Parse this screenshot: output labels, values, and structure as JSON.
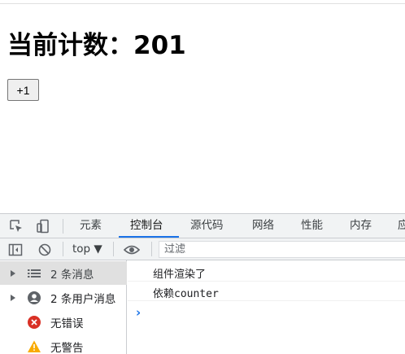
{
  "page": {
    "title": "当前计数：201",
    "increment_button": "+1"
  },
  "devtools": {
    "tabs": [
      {
        "label": "元素",
        "active": false
      },
      {
        "label": "控制台",
        "active": true
      },
      {
        "label": "源代码",
        "active": false
      },
      {
        "label": "网络",
        "active": false
      },
      {
        "label": "性能",
        "active": false
      },
      {
        "label": "内存",
        "active": false
      },
      {
        "label": "应",
        "active": false
      }
    ],
    "toolbar": {
      "context": "top ▼",
      "filter_placeholder": "过滤"
    },
    "sidebar": [
      {
        "label": "2 条消息",
        "icon": "list-icon",
        "selected": true
      },
      {
        "label": "2 条用户消息",
        "icon": "user-icon",
        "selected": false
      },
      {
        "label": "无错误",
        "icon": "error-icon",
        "selected": false
      },
      {
        "label": "无警告",
        "icon": "warning-icon",
        "selected": false
      }
    ],
    "console_messages": [
      "组件渲染了",
      "依赖counter"
    ],
    "prompt_symbol": "›"
  },
  "colors": {
    "accent": "#1a73e8",
    "error": "#d93025",
    "warning": "#f9ab00"
  }
}
